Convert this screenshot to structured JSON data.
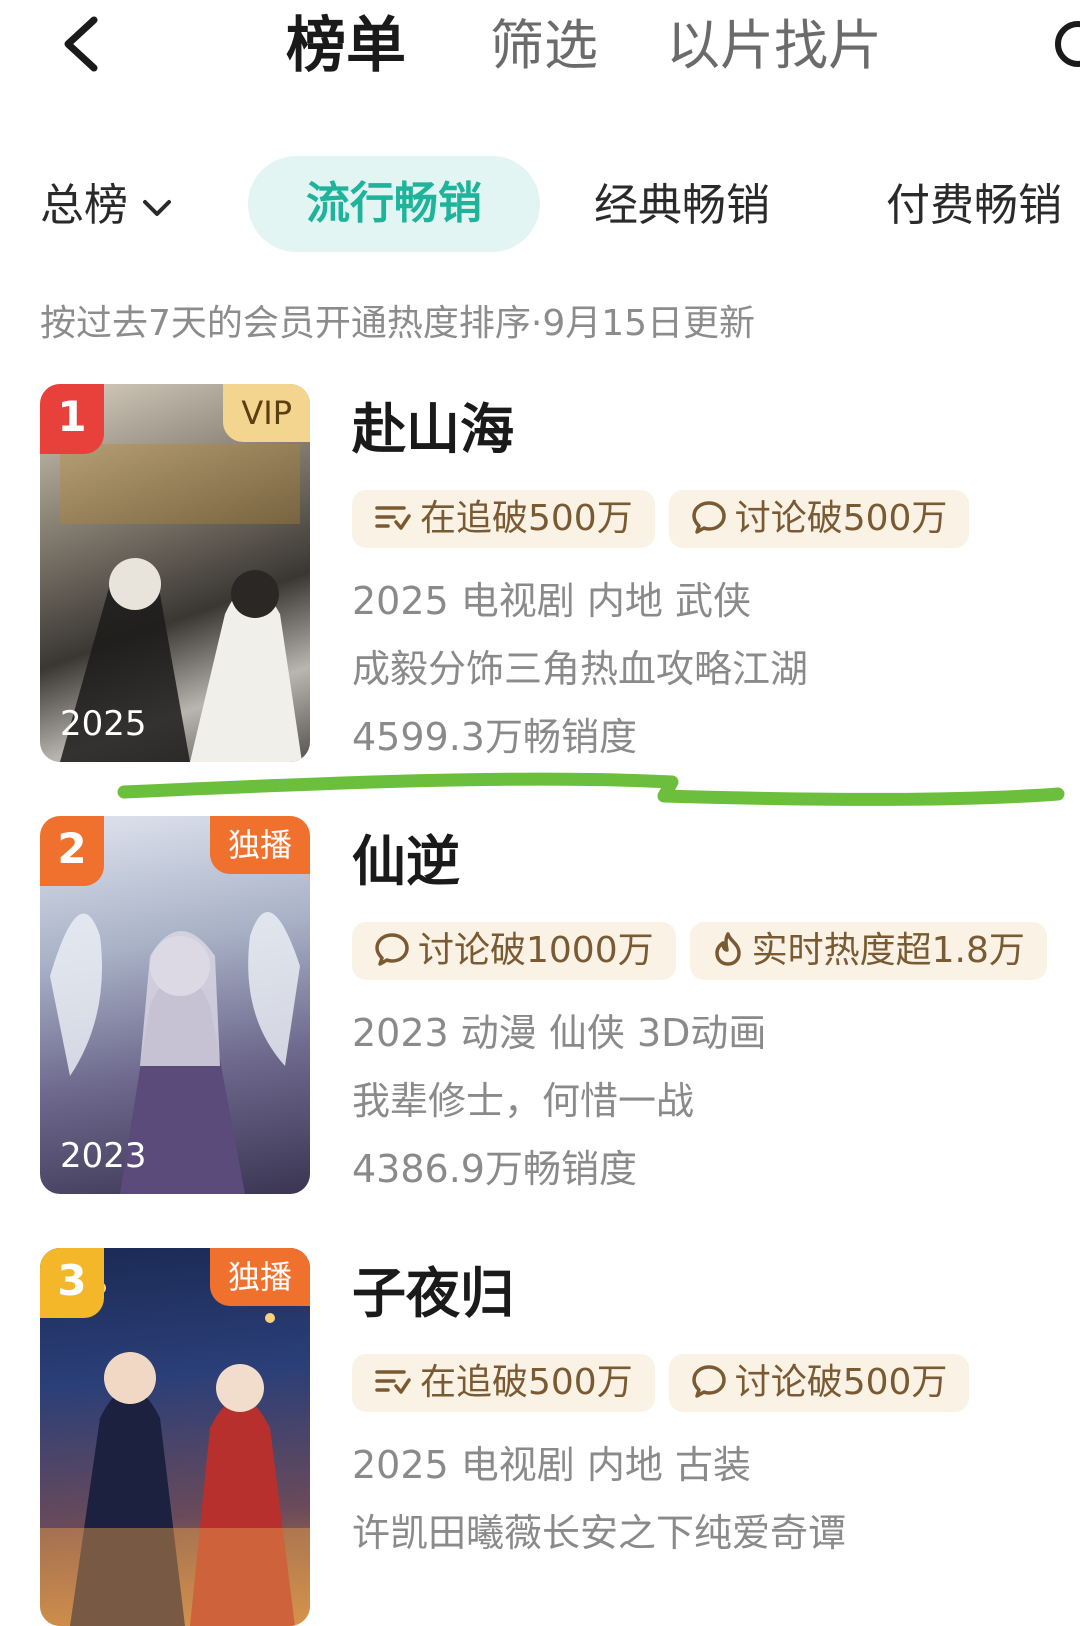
{
  "topbar": {
    "tabs": [
      "榜单",
      "筛选",
      "以片找片"
    ]
  },
  "subtabs": {
    "sort_label": "总榜",
    "items": [
      "流行畅销",
      "经典畅销",
      "付费畅销"
    ]
  },
  "note": "按过去7天的会员开通热度排序·9月15日更新",
  "colors": {
    "accent": "#1eb39b",
    "rank1": "#e8413c",
    "rank2": "#f0702e",
    "rank3": "#f5b72a",
    "annotation_line": "#6cbf3c"
  },
  "items": [
    {
      "rank": "1",
      "badge": "VIP",
      "year": "2025",
      "title": "赴山海",
      "tags": [
        {
          "icon": "following-icon",
          "text": "在追破500万"
        },
        {
          "icon": "comment-icon",
          "text": "讨论破500万"
        }
      ],
      "info": "2025 电视剧 内地 武侠",
      "desc": "成毅分饰三角热血攻略江湖",
      "score": "4599.3万畅销度"
    },
    {
      "rank": "2",
      "badge": "独播",
      "year": "2023",
      "title": "仙逆",
      "tags": [
        {
          "icon": "comment-icon",
          "text": "讨论破1000万"
        },
        {
          "icon": "flame-icon",
          "text": "实时热度超1.8万"
        }
      ],
      "info": "2023 动漫 仙侠 3D动画",
      "desc": "我辈修士，何惜一战",
      "score": "4386.9万畅销度"
    },
    {
      "rank": "3",
      "badge": "独播",
      "year": "",
      "title": "子夜归",
      "tags": [
        {
          "icon": "following-icon",
          "text": "在追破500万"
        },
        {
          "icon": "comment-icon",
          "text": "讨论破500万"
        }
      ],
      "info": "2025 电视剧 内地 古装",
      "desc": "许凯田曦薇长安之下纯爱奇谭",
      "score": ""
    }
  ]
}
